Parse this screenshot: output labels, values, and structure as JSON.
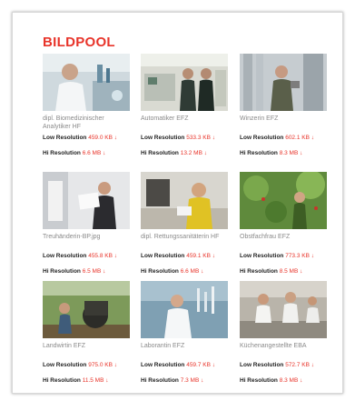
{
  "title": "BILDPOOL",
  "low_label": "Low Resolution",
  "hi_label": "Hi Resolution",
  "download_glyph": "↓",
  "accent_color": "#e8342a",
  "items": [
    {
      "caption": "dipl. Biomedizinischer Analytiker HF",
      "low_size": "459.0 KB",
      "hi_size": "6.6 MB",
      "icon": "download-icon"
    },
    {
      "caption": "Automatiker EFZ",
      "low_size": "533.3 KB",
      "hi_size": "13.2 MB",
      "icon": "download-icon"
    },
    {
      "caption": "Winzerin EFZ",
      "low_size": "602.1 KB",
      "hi_size": "8.3 MB",
      "icon": "download-icon"
    },
    {
      "caption": "Treuhänderin-BP.jpg",
      "low_size": "455.8 KB",
      "hi_size": "6.5 MB",
      "icon": "download-icon"
    },
    {
      "caption": "dipl. Rettungssanitäterin HF",
      "low_size": "459.1 KB",
      "hi_size": "6.6 MB",
      "icon": "download-icon"
    },
    {
      "caption": "Obstfachfrau EFZ",
      "low_size": "773.3 KB",
      "hi_size": "8.5 MB",
      "icon": "download-icon"
    },
    {
      "caption": "Landwirtin EFZ",
      "low_size": "975.0 KB",
      "hi_size": "11.5 MB",
      "icon": "download-icon"
    },
    {
      "caption": "Laborantin EFZ",
      "low_size": "459.7 KB",
      "hi_size": "7.3 MB",
      "icon": "download-icon"
    },
    {
      "caption": "Küchenangestellte EBA",
      "low_size": "572.7 KB",
      "hi_size": "8.3 MB",
      "icon": "download-icon"
    }
  ]
}
